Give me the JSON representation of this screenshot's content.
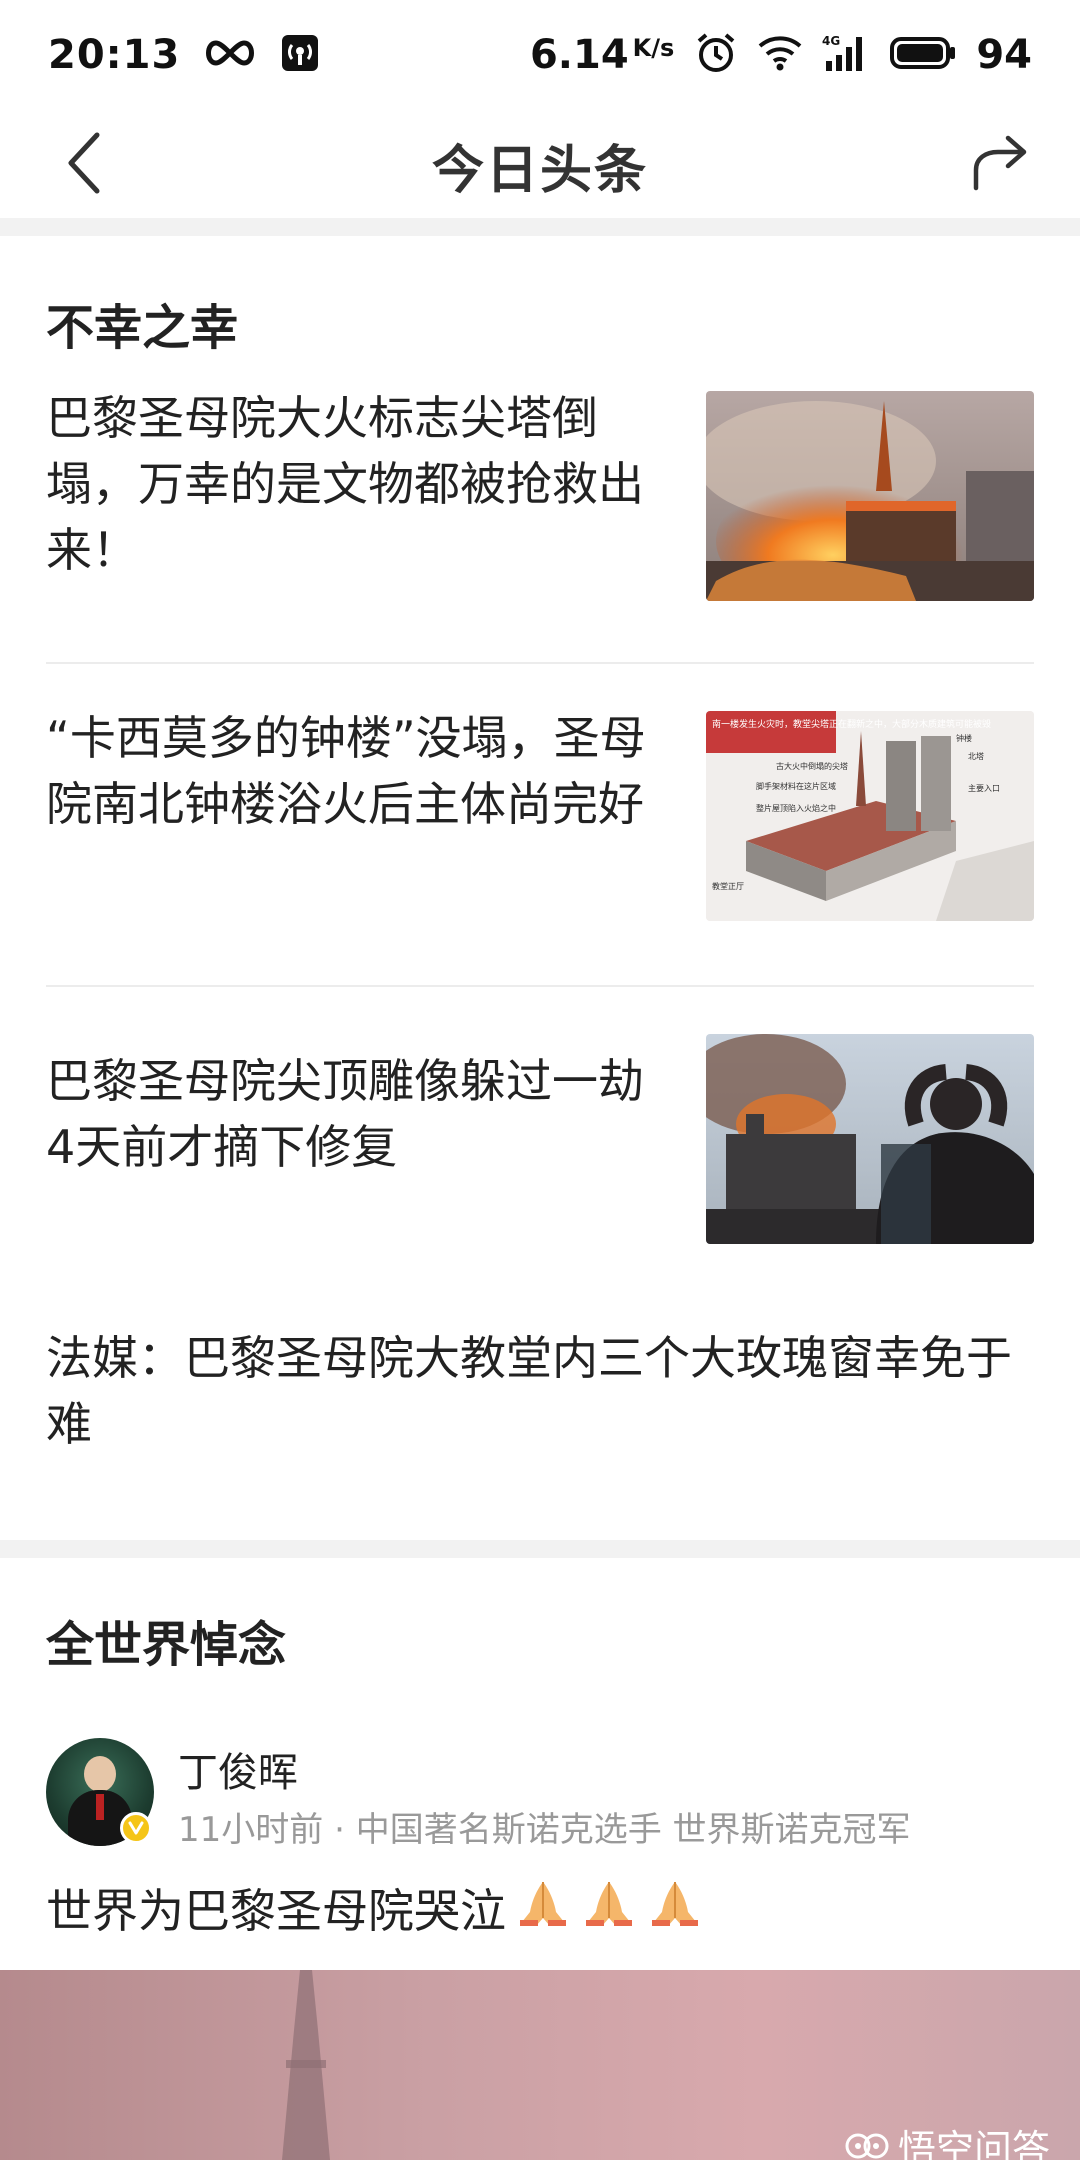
{
  "status_bar": {
    "time": "20:13",
    "net_speed": "6.14",
    "net_unit": "K/s",
    "battery": "94",
    "network_type": "4G"
  },
  "nav": {
    "title": "今日头条"
  },
  "section1": {
    "title": "不幸之幸",
    "items": [
      {
        "title": "巴黎圣母院大火标志尖塔倒塌，万幸的是文物都被抢救出来！",
        "thumb": "fire-spire-photo"
      },
      {
        "title": "“卡西莫多的钟楼”没塌，圣母院南北钟楼浴火后主体尚完好",
        "thumb": "cathedral-diagram",
        "diagram_labels": [
          "南一楼发生火灾时，教堂尖塔正在翻新之中，大部分木质建筑可能被毁",
          "古大火中倒塌的尖塔",
          "脚手架材料在这片区域",
          "整片屋顶陷入火焰之中",
          "钟楼",
          "北塔",
          "主要入口",
          "教堂正厅"
        ]
      },
      {
        "title": "巴黎圣母院尖顶雕像躲过一劫 4天前才摘下修复",
        "thumb": "man-watching-fire"
      },
      {
        "title": "法媒：巴黎圣母院大教堂内三个大玫瑰窗幸免于难"
      }
    ]
  },
  "section2": {
    "title": "全世界悼念",
    "post": {
      "author": "丁俊晖",
      "time": "11小时前",
      "separator": "·",
      "bio": "中国著名斯诺克选手 世界斯诺克冠军",
      "text": "世界为巴黎圣母院哭泣",
      "emoji": [
        "🙏",
        "🙏",
        "🙏"
      ]
    }
  },
  "watermark": {
    "text": "悟空问答"
  },
  "colors": {
    "highlight": "#fbe1e1",
    "divider": "#ececec",
    "band": "#f2f2f2",
    "verified": "#f5c518"
  }
}
